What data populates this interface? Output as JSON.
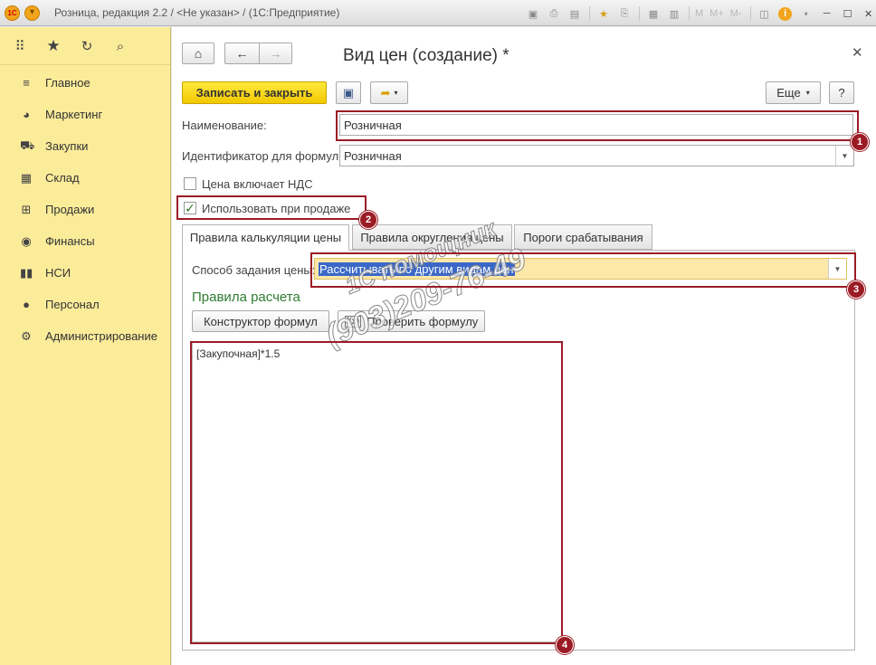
{
  "window": {
    "title": "Розница, редакция 2.2 / <Не указан> / (1С:Предприятие)",
    "logo_text": "1С",
    "toolbar_text_icons": [
      "M",
      "M+",
      "M-"
    ]
  },
  "sidebar": {
    "top_icons": [
      "apps-grid-icon",
      "star-icon",
      "history-icon",
      "search-icon"
    ],
    "items": [
      {
        "label": "Главное",
        "icon": "menu-icon"
      },
      {
        "label": "Маркетинг",
        "icon": "pie-chart-icon"
      },
      {
        "label": "Закупки",
        "icon": "cart-icon"
      },
      {
        "label": "Склад",
        "icon": "warehouse-icon"
      },
      {
        "label": "Продажи",
        "icon": "basket-icon"
      },
      {
        "label": "Финансы",
        "icon": "coin-icon"
      },
      {
        "label": "НСИ",
        "icon": "books-icon"
      },
      {
        "label": "Персонал",
        "icon": "person-icon"
      },
      {
        "label": "Администрирование",
        "icon": "gear-icon"
      }
    ]
  },
  "form": {
    "title": "Вид цен (создание) *",
    "save_close_label": "Записать и закрыть",
    "more_label": "Еще",
    "help_label": "?",
    "name_label": "Наименование:",
    "name_value": "Розничная",
    "formula_id_label": "Идентификатор для формул:",
    "formula_id_value": "Розничная",
    "vat_checkbox_label": "Цена включает НДС",
    "use_in_sale_label": "Использовать при продаже",
    "tabs": [
      {
        "label": "Правила калькуляции цены",
        "active": true
      },
      {
        "label": "Правила округления цены",
        "active": false
      },
      {
        "label": "Пороги срабатывания",
        "active": false
      }
    ],
    "price_method_label": "Способ задания цены:",
    "price_method_value": "Рассчитывать по другим видам цен",
    "rules_title": "Правила расчета",
    "formula_builder_label": "Конструктор формул",
    "check_formula_label": "Проверить формулу",
    "formula_text": "[Закупочная]*1.5"
  },
  "annotations": {
    "badges": [
      "1",
      "2",
      "3",
      "4"
    ],
    "color": "#9b1c25"
  },
  "watermark": {
    "line1": "1С помощник",
    "line2": "(903)209-76-49"
  }
}
